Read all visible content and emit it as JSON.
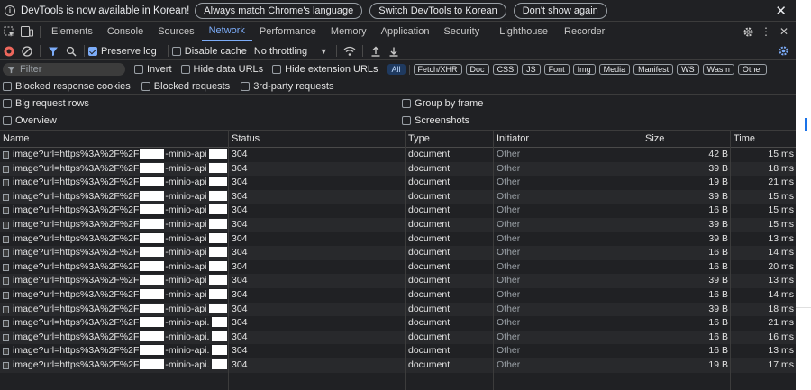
{
  "infobar": {
    "message": "DevTools is now available in Korean!",
    "buttons": [
      "Always match Chrome's language",
      "Switch DevTools to Korean",
      "Don't show again"
    ],
    "close": "✕"
  },
  "tabs": [
    "Elements",
    "Console",
    "Sources",
    "Network",
    "Performance",
    "Memory",
    "Application",
    "Security",
    "Lighthouse",
    "Recorder"
  ],
  "active_tab": "Network",
  "toolbar": {
    "preserve_log": "Preserve log",
    "preserve_log_checked": true,
    "disable_cache": "Disable cache",
    "disable_cache_checked": false,
    "throttling": "No throttling"
  },
  "filter": {
    "placeholder": "Filter",
    "invert": "Invert",
    "hide_data_urls": "Hide data URLs",
    "hide_extension_urls": "Hide extension URLs",
    "types": [
      "All",
      "Fetch/XHR",
      "Doc",
      "CSS",
      "JS",
      "Font",
      "Img",
      "Media",
      "Manifest",
      "WS",
      "Wasm",
      "Other"
    ],
    "active_type": "All"
  },
  "blocked": {
    "cookies": "Blocked response cookies",
    "requests": "Blocked requests",
    "third_party": "3rd-party requests"
  },
  "settings": {
    "big_rows": "Big request rows",
    "group_by_frame": "Group by frame",
    "overview": "Overview",
    "screenshots": "Screenshots"
  },
  "columns": [
    "Name",
    "Status",
    "Type",
    "Initiator",
    "Size",
    "Time"
  ],
  "requests": [
    {
      "name_start": "image?url=https%3A%2F%2F",
      "name_end": "-minio-api",
      "status": "304",
      "type": "document",
      "initiator": "Other",
      "size": "42 B",
      "time": "15 ms"
    },
    {
      "name_start": "image?url=https%3A%2F%2F",
      "name_end": "-minio-api",
      "status": "304",
      "type": "document",
      "initiator": "Other",
      "size": "39 B",
      "time": "18 ms"
    },
    {
      "name_start": "image?url=https%3A%2F%2F",
      "name_end": "-minio-api",
      "status": "304",
      "type": "document",
      "initiator": "Other",
      "size": "19 B",
      "time": "21 ms"
    },
    {
      "name_start": "image?url=https%3A%2F%2F",
      "name_end": "-minio-api",
      "status": "304",
      "type": "document",
      "initiator": "Other",
      "size": "39 B",
      "time": "15 ms"
    },
    {
      "name_start": "image?url=https%3A%2F%2F",
      "name_end": "-minio-api",
      "status": "304",
      "type": "document",
      "initiator": "Other",
      "size": "16 B",
      "time": "15 ms"
    },
    {
      "name_start": "image?url=https%3A%2F%2F",
      "name_end": "-minio-api",
      "status": "304",
      "type": "document",
      "initiator": "Other",
      "size": "39 B",
      "time": "15 ms"
    },
    {
      "name_start": "image?url=https%3A%2F%2F",
      "name_end": "-minio-api",
      "status": "304",
      "type": "document",
      "initiator": "Other",
      "size": "39 B",
      "time": "13 ms"
    },
    {
      "name_start": "image?url=https%3A%2F%2F",
      "name_end": "-minio-api",
      "status": "304",
      "type": "document",
      "initiator": "Other",
      "size": "16 B",
      "time": "14 ms"
    },
    {
      "name_start": "image?url=https%3A%2F%2F",
      "name_end": "-minio-api",
      "status": "304",
      "type": "document",
      "initiator": "Other",
      "size": "16 B",
      "time": "20 ms"
    },
    {
      "name_start": "image?url=https%3A%2F%2F",
      "name_end": "-minio-api",
      "status": "304",
      "type": "document",
      "initiator": "Other",
      "size": "39 B",
      "time": "13 ms"
    },
    {
      "name_start": "image?url=https%3A%2F%2F",
      "name_end": "-minio-api",
      "status": "304",
      "type": "document",
      "initiator": "Other",
      "size": "16 B",
      "time": "14 ms"
    },
    {
      "name_start": "image?url=https%3A%2F%2F",
      "name_end": "-minio-api",
      "status": "304",
      "type": "document",
      "initiator": "Other",
      "size": "39 B",
      "time": "18 ms"
    },
    {
      "name_start": "image?url=https%3A%2F%2F",
      "name_end": "-minio-api.",
      "status": "304",
      "type": "document",
      "initiator": "Other",
      "size": "16 B",
      "time": "21 ms"
    },
    {
      "name_start": "image?url=https%3A%2F%2F",
      "name_end": "-minio-api.",
      "status": "304",
      "type": "document",
      "initiator": "Other",
      "size": "16 B",
      "time": "16 ms"
    },
    {
      "name_start": "image?url=https%3A%2F%2F",
      "name_end": "-minio-api.",
      "status": "304",
      "type": "document",
      "initiator": "Other",
      "size": "16 B",
      "time": "13 ms"
    },
    {
      "name_start": "image?url=https%3A%2F%2F",
      "name_end": "-minio-api.",
      "status": "304",
      "type": "document",
      "initiator": "Other",
      "size": "19 B",
      "time": "17 ms"
    }
  ],
  "colors": {
    "background": "#202124",
    "accent": "#7cacf8",
    "record": "#ee675c",
    "muted": "#9aa0a6"
  }
}
